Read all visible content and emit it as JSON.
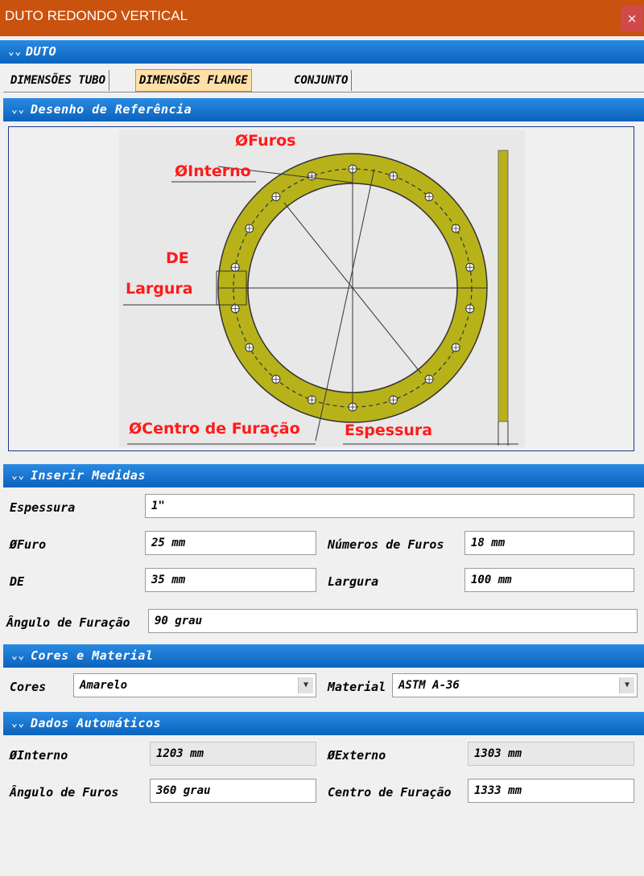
{
  "window": {
    "title": "DUTO REDONDO VERTICAL",
    "close": "×"
  },
  "duto": {
    "title": "DUTO",
    "chevron": "»"
  },
  "tabs": [
    {
      "label": "DIMENSÕES TUBO"
    },
    {
      "label": "DIMENSÕES FLANGE"
    },
    {
      "label": "CONJUNTO"
    }
  ],
  "ref": {
    "title": "Desenho de Referência",
    "labels": {
      "furos": "ØFuros",
      "interno": "ØInterno",
      "de": "DE",
      "largura": "Largura",
      "centro": "ØCentro de Furação",
      "espessura": "Espessura"
    },
    "flange_color": "#b8b21a",
    "label_color": "#ff1a1a"
  },
  "inserir": {
    "title": "Inserir Medidas",
    "espessura": {
      "label": "Espessura",
      "value": "1\""
    },
    "furo": {
      "label": "ØFuro",
      "value": "25 mm"
    },
    "num_furos": {
      "label": "Números de Furos",
      "value": "18 mm"
    },
    "de": {
      "label": "DE",
      "value": "35 mm"
    },
    "largura": {
      "label": "Largura",
      "value": "100 mm"
    },
    "angulo": {
      "label": "Ângulo de Furação",
      "value": "90 grau"
    }
  },
  "cores": {
    "title": "Cores e Material",
    "cores": {
      "label": "Cores",
      "value": "Amarelo"
    },
    "material": {
      "label": "Material",
      "value": "ASTM A-36"
    }
  },
  "auto": {
    "title": "Dados Automáticos",
    "interno": {
      "label": "ØInterno",
      "value": "1203 mm"
    },
    "externo": {
      "label": "ØExterno",
      "value": "1303 mm"
    },
    "angulo_furos": {
      "label": "Ângulo de Furos",
      "value": "360 grau"
    },
    "centro": {
      "label": "Centro de Furação",
      "value": "1333 mm"
    }
  }
}
